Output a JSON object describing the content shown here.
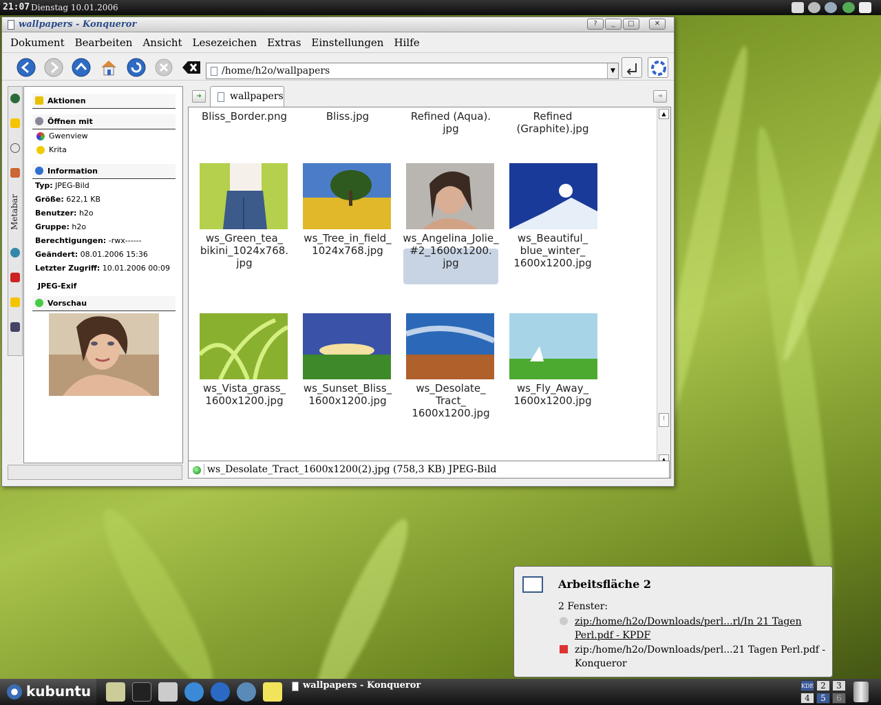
{
  "top_panel": {
    "clock": "21:07",
    "date": "Dienstag  10.01.2006"
  },
  "window": {
    "title": "wallpapers - Konqueror",
    "menu": [
      "Dokument",
      "Bearbeiten",
      "Ansicht",
      "Lesezeichen",
      "Extras",
      "Einstellungen",
      "Hilfe"
    ],
    "location": "/home/h2o/wallpapers",
    "tab_label": "wallpapers",
    "sidebar_tab_label": "Metabar"
  },
  "metabar": {
    "actions": "Aktionen",
    "open_with": "Öffnen mit",
    "open_apps": [
      "Gwenview",
      "Krita"
    ],
    "information": "Information",
    "info": [
      {
        "key": "Typ:",
        "value": "JPEG-Bild"
      },
      {
        "key": "Größe:",
        "value": "622,1 KB"
      },
      {
        "key": "Benutzer:",
        "value": "h2o"
      },
      {
        "key": "Gruppe:",
        "value": "h2o"
      },
      {
        "key": "Berechtigungen:",
        "value": "-rwx------"
      },
      {
        "key": "Geändert:",
        "value": "08.01.2006 15:36"
      },
      {
        "key": "Letzter Zugriff:",
        "value": "10.01.2006 00:09"
      }
    ],
    "exif": "JPEG-Exif",
    "preview": "Vorschau"
  },
  "files": {
    "row0": [
      "Bliss_Border.png",
      "Bliss.jpg",
      "Refined (Aqua).\njpg",
      "Refined\n(Graphite).jpg"
    ],
    "row1": [
      "ws_Green_tea_\nbikini_1024x768.\njpg",
      "ws_Tree_in_field_\n1024x768.jpg",
      "ws_Angelina_Jolie_\n#2_1600x1200.\njpg",
      "ws_Beautiful_\nblue_winter_\n1600x1200.jpg"
    ],
    "row2": [
      "ws_Vista_grass_\n1600x1200.jpg",
      "ws_Sunset_Bliss_\n1600x1200.jpg",
      "ws_Desolate_\nTract_\n1600x1200.jpg",
      "ws_Fly_Away_\n1600x1200.jpg"
    ]
  },
  "statusbar": "ws_Desolate_Tract_1600x1200(2).jpg (758,3 KB)  JPEG-Bild",
  "popup": {
    "title": "Arbeitsfläche 2",
    "subtitle": "2 Fenster:",
    "entry1": "zip:/home/h2o/Downloads/perl...rl/In 21 Tagen Perl.pdf - KPDF",
    "entry2": "zip:/home/h2o/Downloads/perl...21 Tagen Perl.pdf - Konqueror"
  },
  "taskbar": {
    "kmenu": "kubuntu",
    "task": "wallpapers - Konqueror",
    "pager": [
      "KDE",
      "2",
      "3",
      "4",
      "5",
      "6"
    ]
  }
}
